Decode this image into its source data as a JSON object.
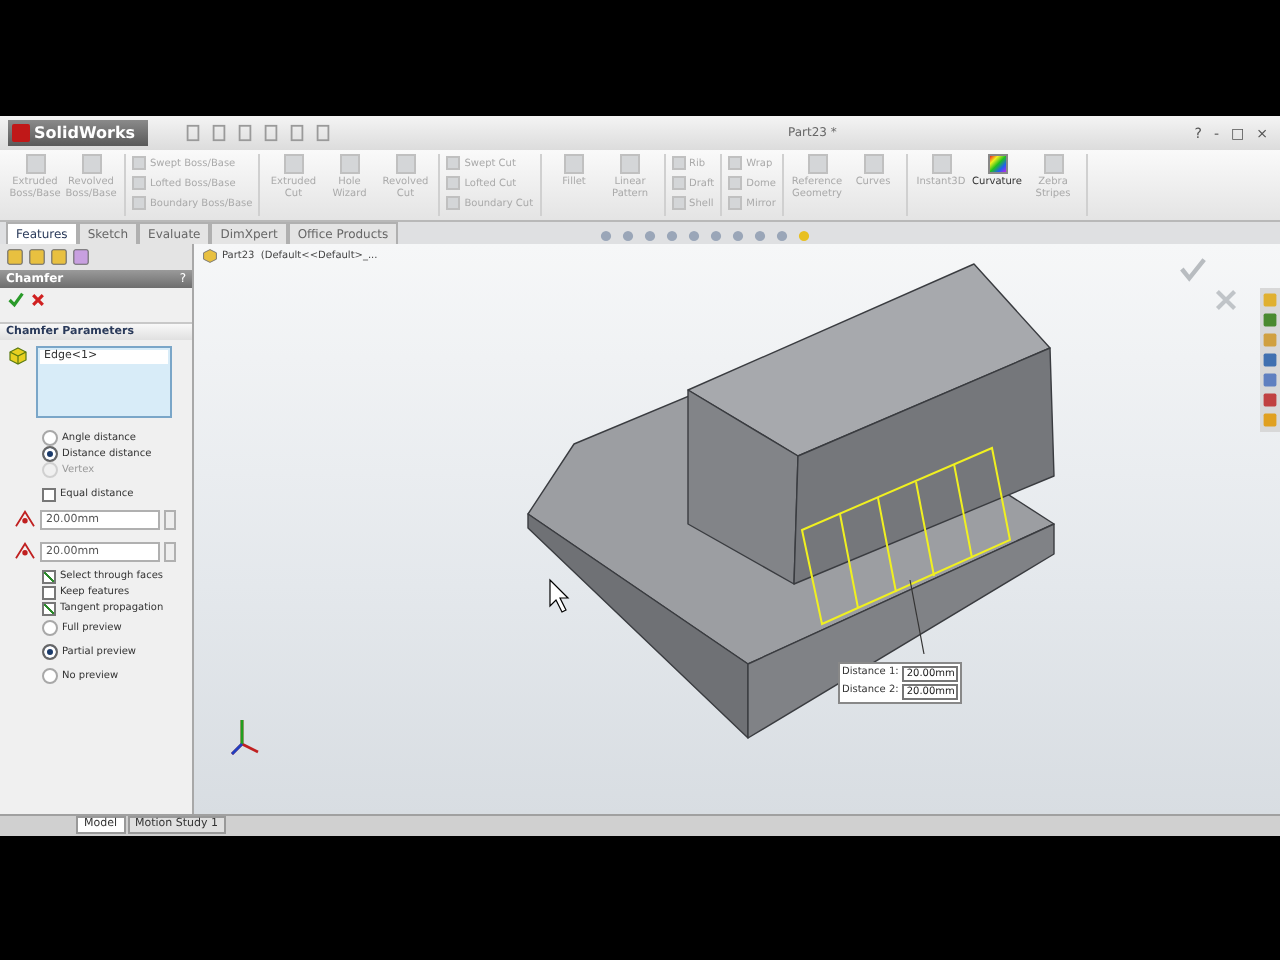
{
  "window": {
    "app_name": "SolidWorks",
    "title": "Part23 *",
    "controls": [
      "?",
      "-",
      "□",
      "×"
    ]
  },
  "ribbon": {
    "groups": [
      {
        "kind": "large",
        "items": [
          {
            "label": "Extruded Boss/Base",
            "disabled": true
          },
          {
            "label": "Revolved Boss/Base",
            "disabled": true
          }
        ]
      },
      {
        "kind": "stack",
        "items": [
          {
            "label": "Swept Boss/Base",
            "disabled": true
          },
          {
            "label": "Lofted Boss/Base",
            "disabled": true
          },
          {
            "label": "Boundary Boss/Base",
            "disabled": true
          }
        ]
      },
      {
        "kind": "large",
        "items": [
          {
            "label": "Extruded Cut",
            "disabled": true
          },
          {
            "label": "Hole Wizard",
            "disabled": true
          },
          {
            "label": "Revolved Cut",
            "disabled": true
          }
        ]
      },
      {
        "kind": "stack",
        "items": [
          {
            "label": "Swept Cut",
            "disabled": true
          },
          {
            "label": "Lofted Cut",
            "disabled": true
          },
          {
            "label": "Boundary Cut",
            "disabled": true
          }
        ]
      },
      {
        "kind": "large",
        "items": [
          {
            "label": "Fillet",
            "disabled": true
          },
          {
            "label": "Linear Pattern",
            "disabled": true
          }
        ]
      },
      {
        "kind": "stack",
        "items": [
          {
            "label": "Rib",
            "disabled": true
          },
          {
            "label": "Draft",
            "disabled": true
          },
          {
            "label": "Shell",
            "disabled": true
          }
        ]
      },
      {
        "kind": "stack",
        "items": [
          {
            "label": "Wrap",
            "disabled": true
          },
          {
            "label": "Dome",
            "disabled": true
          },
          {
            "label": "Mirror",
            "disabled": true
          }
        ]
      },
      {
        "kind": "large",
        "items": [
          {
            "label": "Reference Geometry",
            "disabled": true
          },
          {
            "label": "Curves",
            "disabled": true
          }
        ]
      },
      {
        "kind": "large",
        "items": [
          {
            "label": "Instant3D",
            "disabled": true
          },
          {
            "label": "Curvature",
            "disabled": false
          },
          {
            "label": "Zebra Stripes",
            "disabled": true
          }
        ]
      }
    ]
  },
  "tabs": [
    {
      "label": "Features",
      "selected": true
    },
    {
      "label": "Sketch",
      "selected": false
    },
    {
      "label": "Evaluate",
      "selected": false
    },
    {
      "label": "DimXpert",
      "selected": false
    },
    {
      "label": "Office Products",
      "selected": false
    }
  ],
  "property_manager": {
    "title": "Chamfer",
    "help": "?",
    "section": "Chamfer Parameters",
    "selection": "Edge<1>",
    "type_options": [
      {
        "label": "Angle distance",
        "selected": false,
        "disabled": false
      },
      {
        "label": "Distance distance",
        "selected": true,
        "disabled": false
      },
      {
        "label": "Vertex",
        "selected": false,
        "disabled": true
      }
    ],
    "equal_distance": {
      "label": "Equal distance",
      "checked": false
    },
    "distances": [
      "20.00mm",
      "20.00mm"
    ],
    "options": [
      {
        "label": "Select through faces",
        "checked": true
      },
      {
        "label": "Keep features",
        "checked": false
      },
      {
        "label": "Tangent propagation",
        "checked": true
      }
    ],
    "preview": [
      {
        "label": "Full preview",
        "selected": false
      },
      {
        "label": "Partial preview",
        "selected": true
      },
      {
        "label": "No preview",
        "selected": false
      }
    ]
  },
  "breadcrumb": "Part23  (Default<<Default>_...",
  "callout": [
    {
      "label": "Distance 1:",
      "value": "20.00mm"
    },
    {
      "label": "Distance 2:",
      "value": "20.00mm"
    }
  ],
  "bottom_tabs": [
    {
      "label": "Model",
      "selected": true
    },
    {
      "label": "Motion Study 1",
      "selected": false
    }
  ]
}
